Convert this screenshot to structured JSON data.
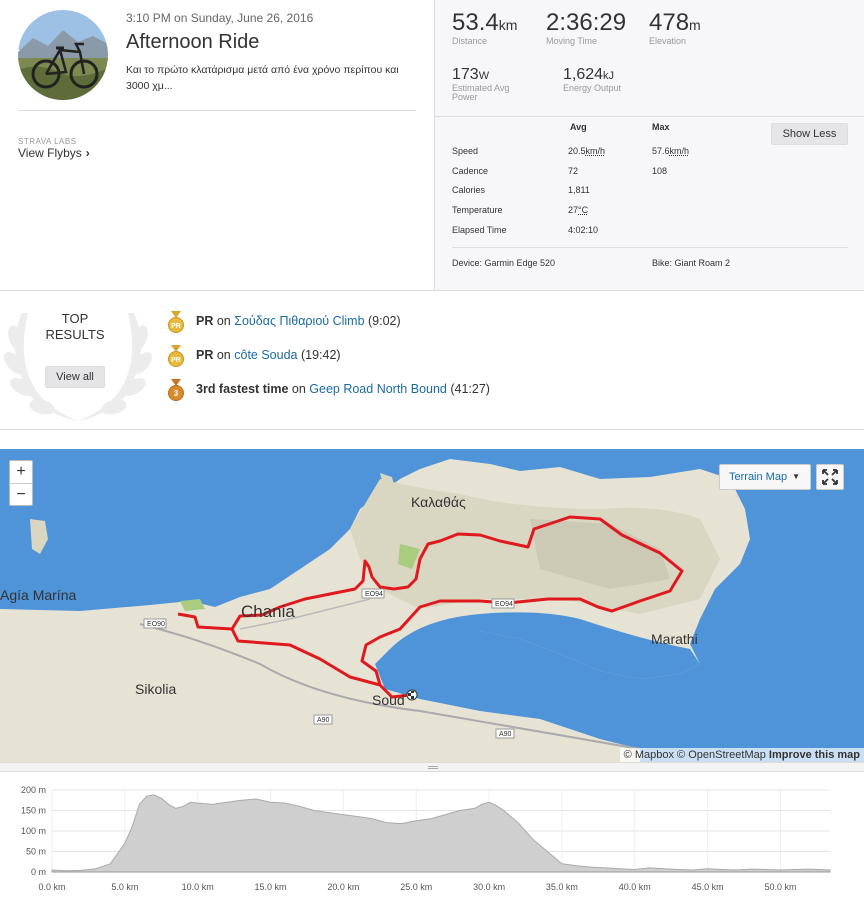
{
  "activity": {
    "datetime": "3:10 PM on Sunday, June 26, 2016",
    "title": "Afternoon Ride",
    "description": "Και το πρώτο κλατάρισμα μετά από ένα χρόνο περίπου και 3000 χμ...",
    "labs_label": "STRAVA LABS",
    "flybys_label": "View Flybys"
  },
  "stats": {
    "distance": {
      "value": "53.4",
      "unit": "km",
      "label": "Distance"
    },
    "moving_time": {
      "value": "2:36:29",
      "label": "Moving Time"
    },
    "elevation": {
      "value": "478",
      "unit": "m",
      "label": "Elevation"
    },
    "power": {
      "value": "173",
      "unit": "W",
      "label1": "Estimated Avg",
      "label2": "Power"
    },
    "energy": {
      "value": "1,624",
      "unit": "kJ",
      "label": "Energy Output"
    }
  },
  "more_stats": {
    "col_avg": "Avg",
    "col_max": "Max",
    "show_less": "Show Less",
    "rows": [
      {
        "label": "Speed",
        "avg": "20.5",
        "avg_unit": "km/h",
        "max": "57.6",
        "max_unit": "km/h"
      },
      {
        "label": "Cadence",
        "avg": "72",
        "avg_unit": "",
        "max": "108",
        "max_unit": ""
      },
      {
        "label": "Calories",
        "avg": "1,811",
        "avg_unit": "",
        "max": "",
        "max_unit": ""
      },
      {
        "label": "Temperature",
        "avg": "27",
        "avg_unit": "°C",
        "max": "",
        "max_unit": ""
      },
      {
        "label": "Elapsed Time",
        "avg": "4:02:10",
        "avg_unit": "",
        "max": "",
        "max_unit": ""
      }
    ],
    "device": "Device: Garmin Edge 520",
    "bike": "Bike: Giant Roam 2"
  },
  "top_results": {
    "title_line1": "TOP",
    "title_line2": "RESULTS",
    "view_all": "View all",
    "items": [
      {
        "rank": "PR",
        "prefix": "PR",
        "on": "on",
        "segment": "Σούδας Πιθαριού Climb",
        "time": "(9:02)",
        "medal_color": "#e8b93a"
      },
      {
        "rank": "PR",
        "prefix": "PR",
        "on": "on",
        "segment": "côte Souda",
        "time": "(19:42)",
        "medal_color": "#e8b93a"
      },
      {
        "rank": "3",
        "prefix": "3rd fastest time",
        "on": "on",
        "segment": "Geep Road North Bound",
        "time": "(41:27)",
        "medal_color": "#d98a2b"
      }
    ]
  },
  "map": {
    "zoom_in": "+",
    "zoom_out": "−",
    "style_label": "Terrain Map",
    "attribution_mapbox": "© Mapbox",
    "attribution_osm": "© OpenStreetMap",
    "improve": "Improve this map",
    "places": {
      "kalathas": "Καλαθάς",
      "agia_marina": "Agía Marína",
      "chania": "Chania",
      "sikolia": "Sikolia",
      "souda": "Soud",
      "marathi": "Marathi"
    },
    "roads": [
      "EO90",
      "EO94",
      "EO94",
      "A90",
      "A90"
    ],
    "route_color": "#e0191f",
    "water_color": "#4a90d6"
  },
  "elevation_chart": {
    "y_ticks": [
      "200 m",
      "150 m",
      "100 m",
      "50 m",
      "0 m"
    ],
    "x_ticks": [
      "0.0 km",
      "5.0 km",
      "10.0 km",
      "15.0 km",
      "20.0 km",
      "25.0 km",
      "30.0 km",
      "35.0 km",
      "40.0 km",
      "45.0 km",
      "50.0 km"
    ]
  },
  "chart_data": {
    "type": "area",
    "xlabel": "",
    "ylabel": "",
    "xlim": [
      0,
      53.4
    ],
    "ylim": [
      0,
      200
    ],
    "x": [
      0,
      1,
      2,
      3,
      4,
      5,
      5.5,
      6,
      6.5,
      7,
      7.5,
      8,
      8.5,
      9,
      9.5,
      10,
      11,
      12,
      13,
      14,
      15,
      16,
      17,
      18,
      19,
      20,
      21,
      22,
      23,
      24,
      25,
      26,
      27,
      28,
      29,
      29.5,
      30,
      30.5,
      31,
      32,
      33,
      34,
      35,
      36,
      37,
      38,
      39,
      40,
      41,
      42,
      43,
      44,
      45,
      46,
      47,
      48,
      49,
      50,
      51,
      52,
      53.4
    ],
    "series": [
      {
        "values": [
          5,
          3,
          4,
          8,
          20,
          70,
          110,
          165,
          185,
          188,
          180,
          165,
          155,
          160,
          170,
          168,
          165,
          170,
          175,
          178,
          170,
          168,
          160,
          150,
          145,
          140,
          135,
          130,
          120,
          118,
          125,
          130,
          140,
          150,
          155,
          165,
          170,
          162,
          150,
          120,
          80,
          50,
          20,
          15,
          12,
          10,
          8,
          6,
          10,
          8,
          6,
          5,
          8,
          6,
          5,
          7,
          6,
          5,
          6,
          7,
          5
        ]
      }
    ]
  }
}
